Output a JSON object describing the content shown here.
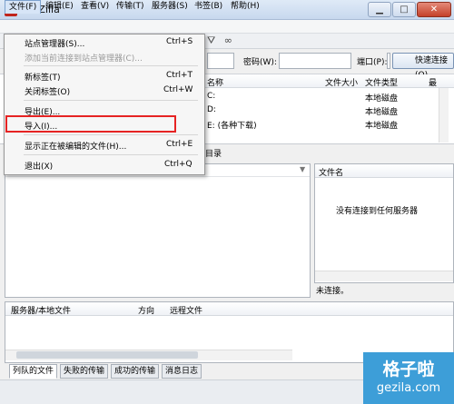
{
  "window": {
    "title": "FileZilla",
    "app_icon_glyph": "Z"
  },
  "menubar": {
    "items": [
      "文件(F)",
      "编辑(E)",
      "查看(V)",
      "传输(T)",
      "服务器(S)",
      "书签(B)",
      "帮助(H)"
    ]
  },
  "quickconnect": {
    "password_label": "密码(W):",
    "port_label": "端口(P):",
    "connect_label": "快速连接(Q)"
  },
  "local_list": {
    "columns": [
      "名称",
      "文件大小",
      "文件类型",
      "最"
    ],
    "rows": [
      {
        "name": "C:",
        "type": "本地磁盘"
      },
      {
        "name": "D:",
        "type": "本地磁盘"
      },
      {
        "name": "E: (各种下载)",
        "type": "本地磁盘"
      }
    ]
  },
  "remote": {
    "dir_label": "目录",
    "column": "文件名",
    "empty_message": "没有连接到任何服务器",
    "status": "未连接。"
  },
  "queue": {
    "columns": [
      "服务器/本地文件",
      "方向",
      "远程文件"
    ]
  },
  "tabs": [
    "列队的文件",
    "失败的传输",
    "成功的传输",
    "消息日志"
  ],
  "dropdown": {
    "items": [
      {
        "label": "站点管理器(S)...",
        "shortcut": "Ctrl+S",
        "enabled": true
      },
      {
        "label": "添加当前连接到站点管理器(C)...",
        "shortcut": "",
        "enabled": false
      },
      {
        "label": "新标签(T)",
        "shortcut": "Ctrl+T",
        "enabled": true
      },
      {
        "label": "关闭标签(O)",
        "shortcut": "Ctrl+W",
        "enabled": true
      },
      {
        "label": "导出(E)...",
        "shortcut": "",
        "enabled": true
      },
      {
        "label": "导入(I)...",
        "shortcut": "",
        "enabled": true
      },
      {
        "label": "显示正在被编辑的文件(H)...",
        "shortcut": "Ctrl+E",
        "enabled": true
      },
      {
        "label": "退出(X)",
        "shortcut": "Ctrl+Q",
        "enabled": true
      }
    ],
    "highlight_color": "#e62323"
  },
  "watermark": {
    "title": "格子啦",
    "url": "gezila.com"
  },
  "colors": {
    "accent": "#3d9ed8",
    "menu_highlight": "#d7e5f7"
  }
}
